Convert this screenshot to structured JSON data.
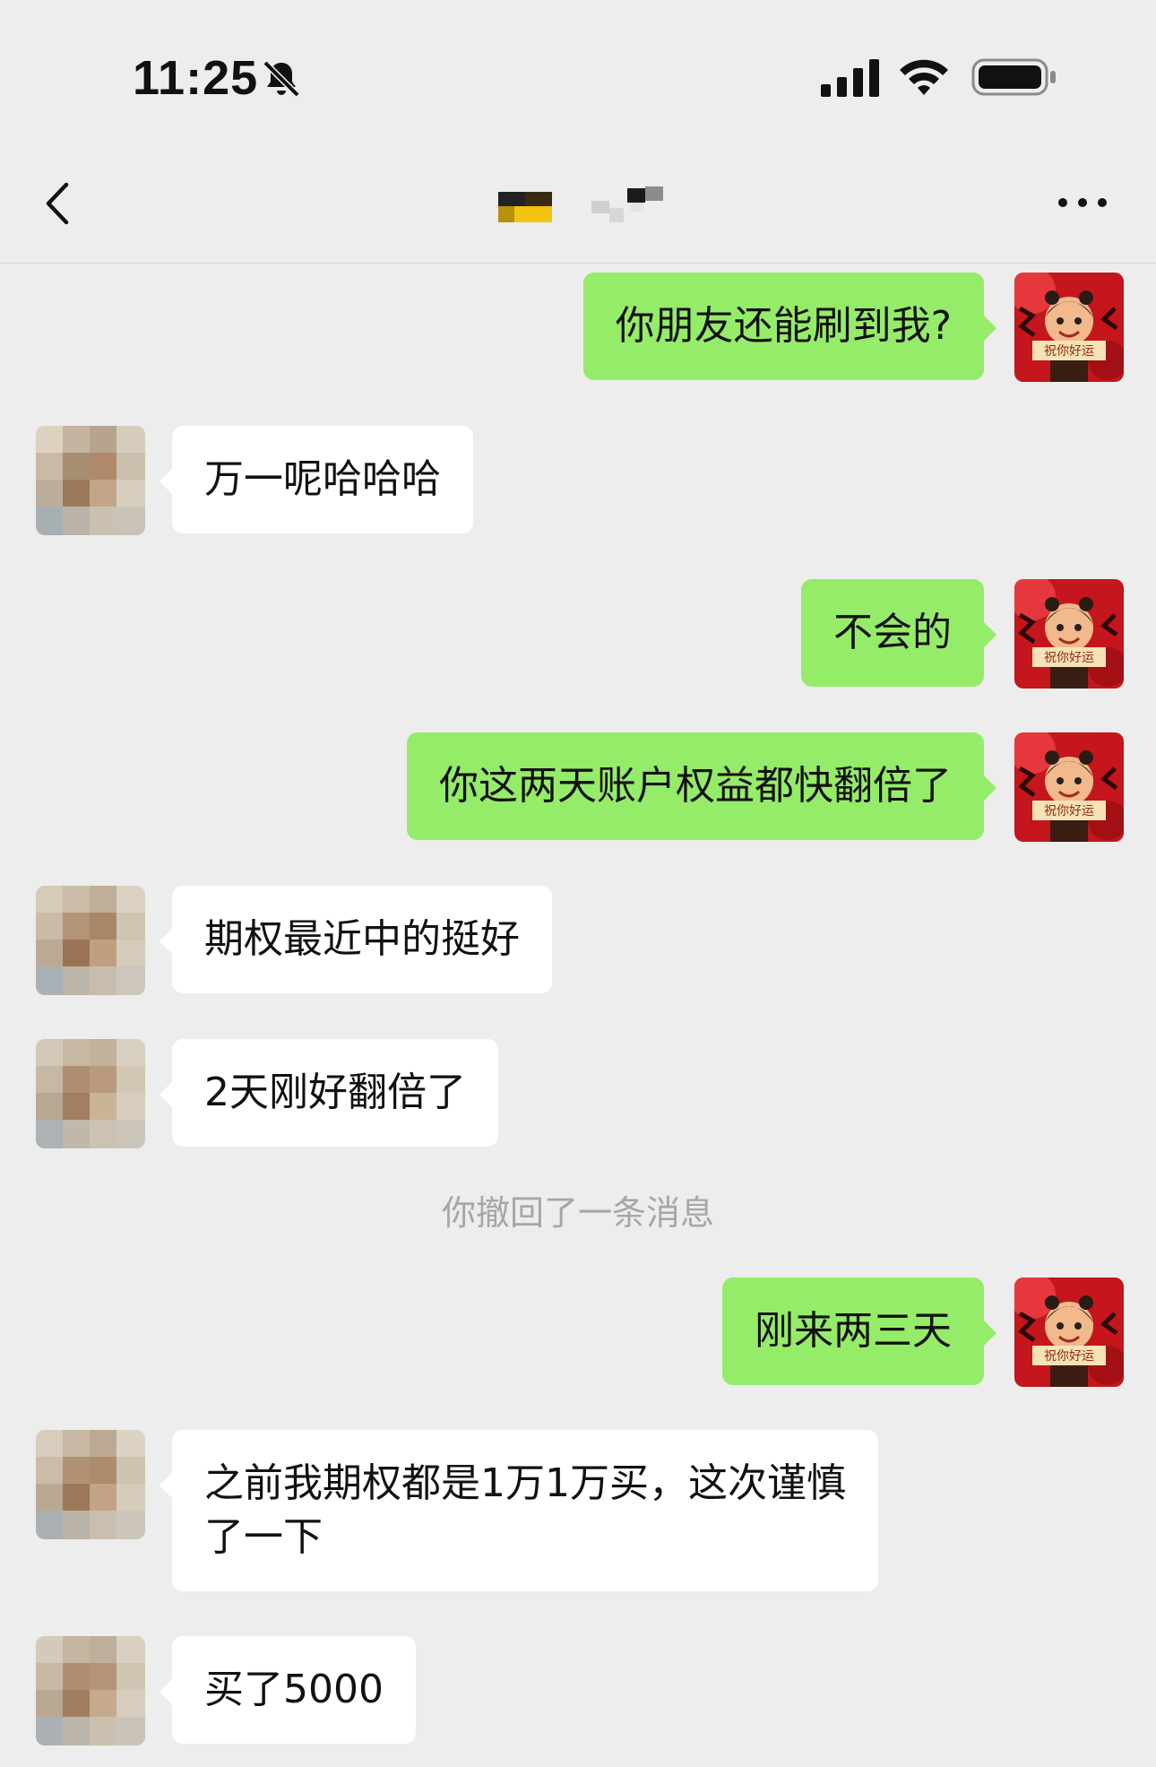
{
  "status_bar": {
    "time": "11:25"
  },
  "colors": {
    "background": "#ededed",
    "sent_bubble": "#95ec69",
    "received_bubble": "#ffffff",
    "system_text": "#a6a6a6"
  },
  "icons": [
    "bell-slash-icon",
    "cellular-signal-icon",
    "wifi-icon",
    "battery-icon",
    "back-chevron-icon",
    "more-dots-icon"
  ],
  "chat": {
    "messages": [
      {
        "side": "me",
        "text": "你朋友还能刷到我?"
      },
      {
        "side": "other",
        "text": "万一呢哈哈哈"
      },
      {
        "side": "me",
        "text": "不会的"
      },
      {
        "side": "me",
        "text": "你这两天账户权益都快翻倍了"
      },
      {
        "side": "other",
        "text": "期权最近中的挺好"
      },
      {
        "side": "other",
        "text": "2天刚好翻倍了"
      },
      {
        "side": "me",
        "text": "刚来两三天"
      },
      {
        "side": "other",
        "text": "之前我期权都是1万1万买，这次谨慎\n了一下"
      },
      {
        "side": "other",
        "text": "买了5000"
      }
    ],
    "recall_notice": "你撤回了一条消息",
    "my_avatar_caption": "祝你好运"
  }
}
